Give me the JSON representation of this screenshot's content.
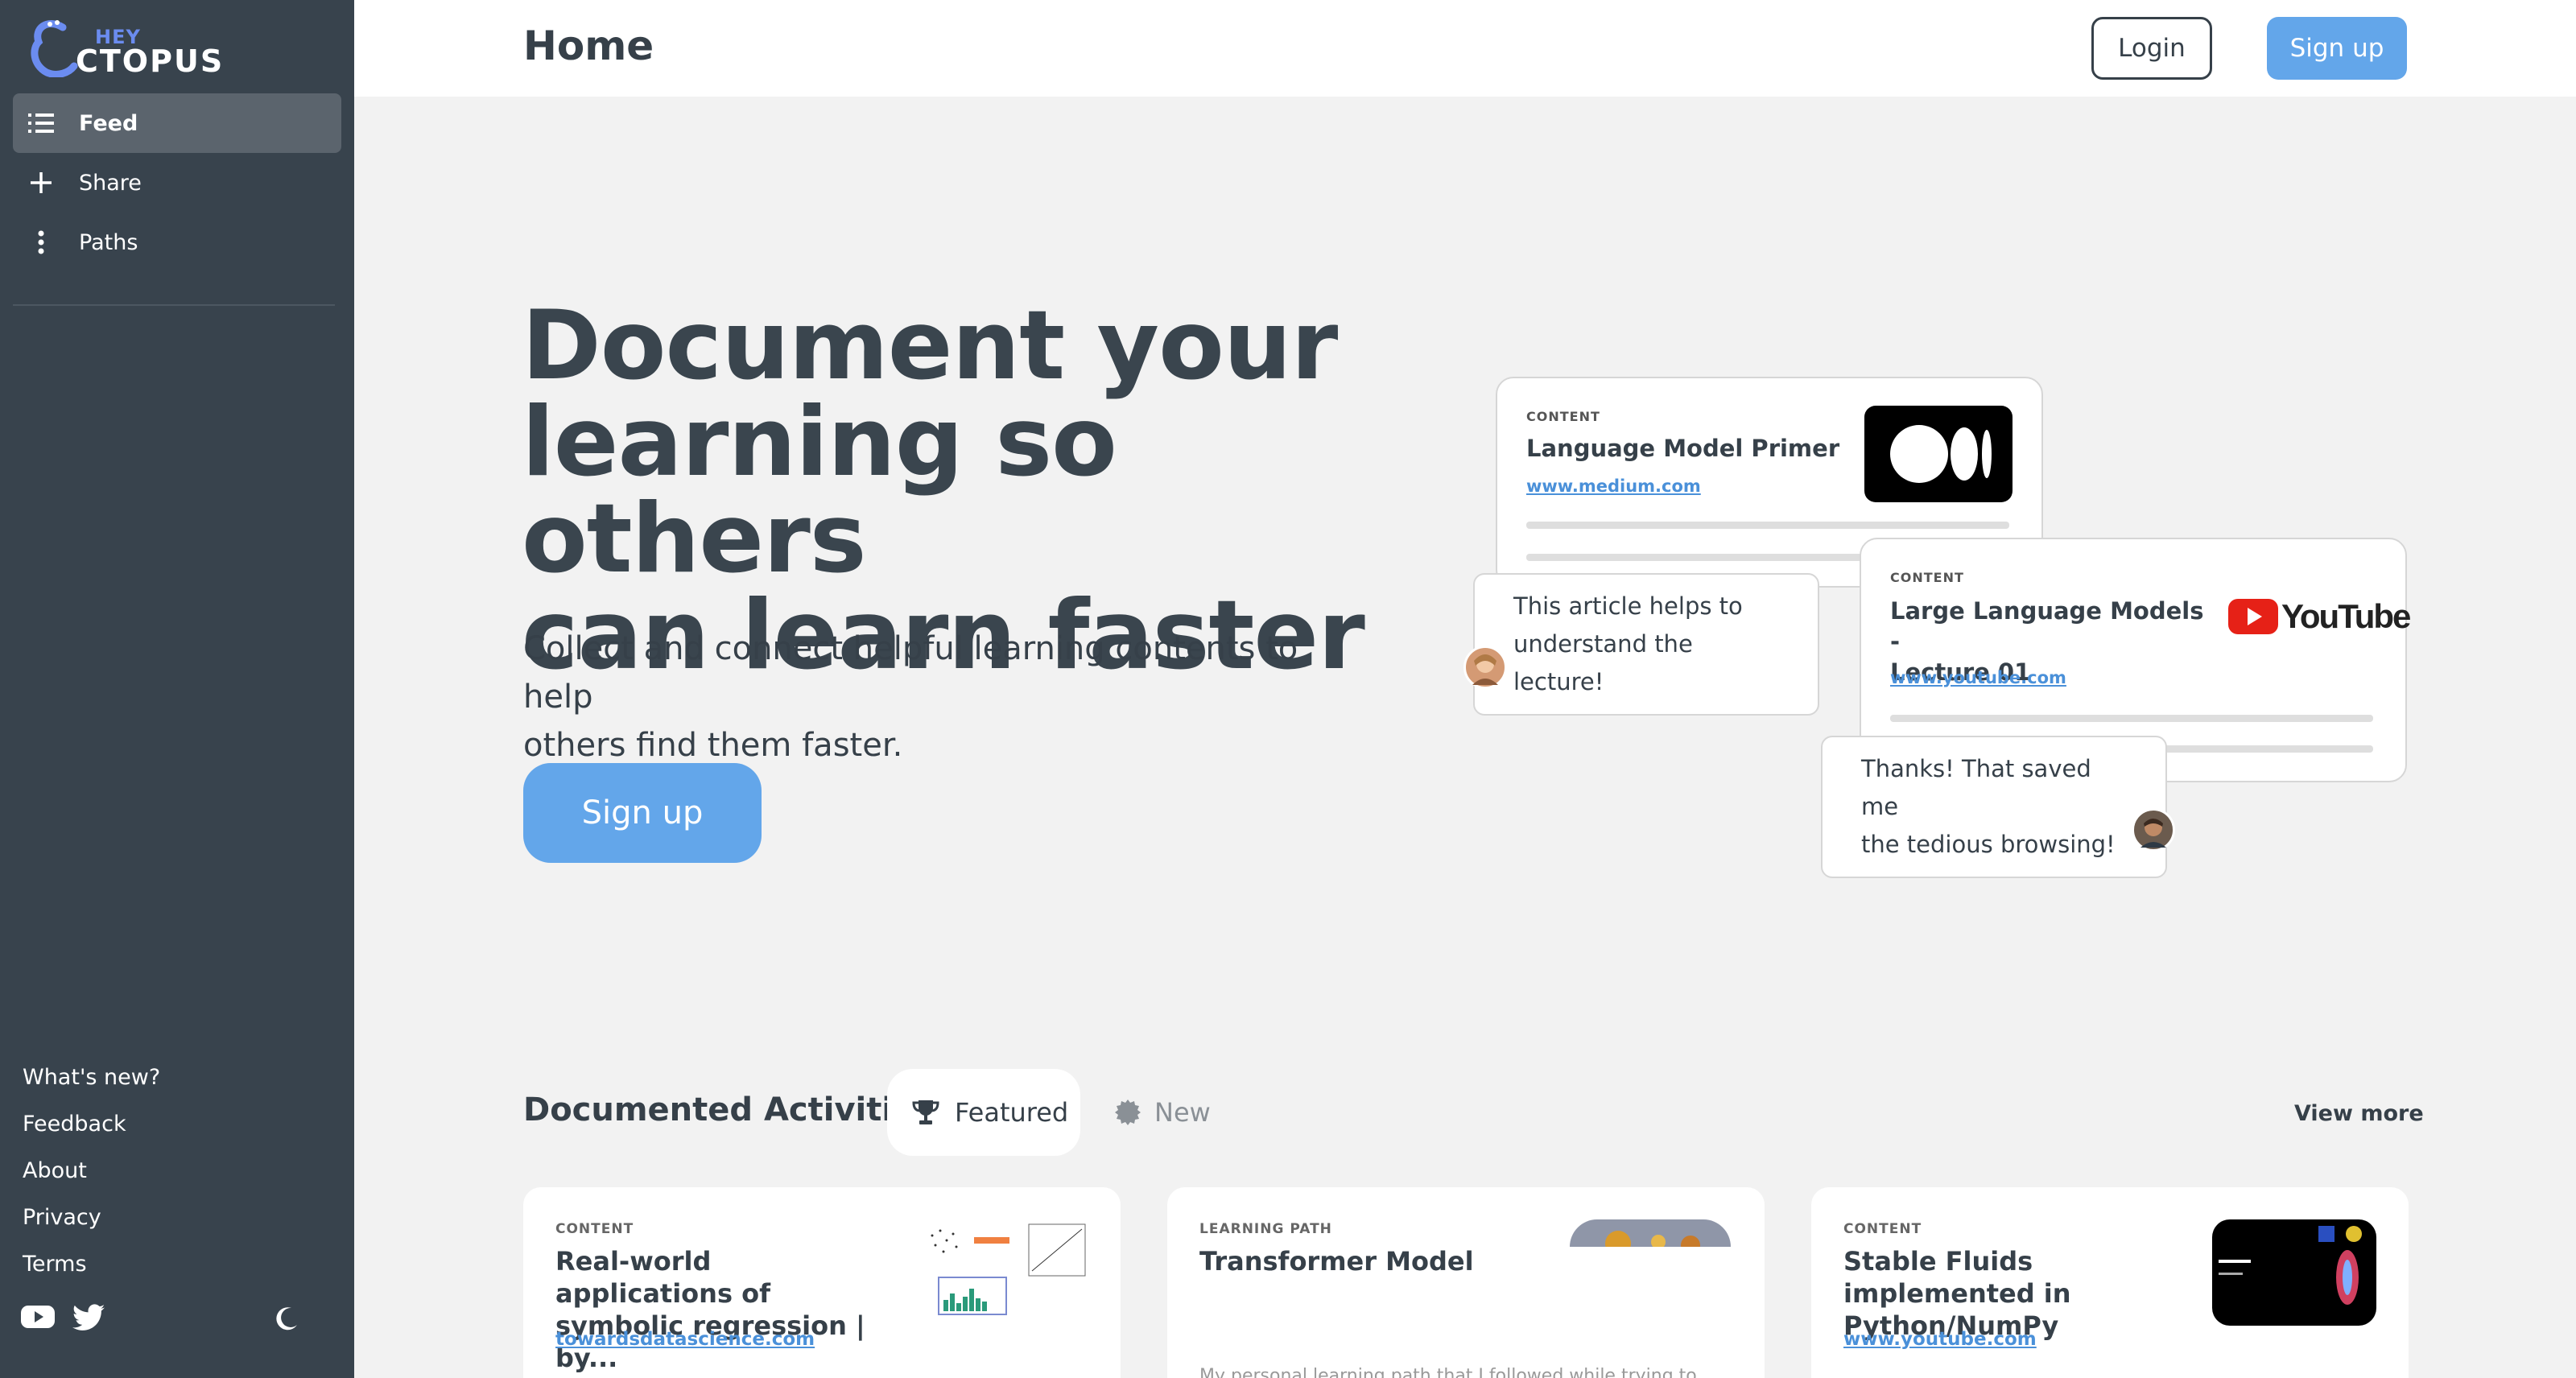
{
  "brand": {
    "hey": "HEY",
    "name": "CTOPUS"
  },
  "sidebar": {
    "nav": [
      {
        "label": "Feed",
        "icon": "list-icon",
        "active": true
      },
      {
        "label": "Share",
        "icon": "plus-icon",
        "active": false
      },
      {
        "label": "Paths",
        "icon": "more-vertical-icon",
        "active": false
      }
    ],
    "footer": [
      "What's new?",
      "Feedback",
      "About",
      "Privacy",
      "Terms"
    ],
    "social": [
      "youtube-icon",
      "twitter-icon"
    ],
    "theme_toggle": "moon-icon"
  },
  "header": {
    "title": "Home",
    "login": "Login",
    "signup": "Sign up"
  },
  "hero": {
    "title_lines": [
      "Document your",
      "learning so others",
      "can learn faster"
    ],
    "subtitle_lines": [
      "Collect and connect helpful learning contents to help",
      "others find them faster."
    ],
    "cta": "Sign up"
  },
  "illustration": {
    "card1": {
      "tag": "CONTENT",
      "title": "Language Model Primer",
      "link": "www.medium.com"
    },
    "card2": {
      "tag": "CONTENT",
      "title_lines": [
        "Large Language Models -",
        "Lecture 01"
      ],
      "link": "www.youtube.com",
      "logo_text": "YouTube"
    },
    "bubble1": [
      "This article helps to",
      "understand the lecture!"
    ],
    "bubble2": [
      "Thanks! That saved me",
      "the tedious browsing!"
    ]
  },
  "activities": {
    "title": "Documented Activities",
    "tabs": [
      "Featured",
      "New"
    ],
    "view_more": "View more",
    "cards": [
      {
        "tag": "CONTENT",
        "title_lines": [
          "Real-world applications of",
          "symbolic regression | by..."
        ],
        "link": "towardsdatascience.com"
      },
      {
        "tag": "LEARNING PATH",
        "title_lines": [
          "Transformer Model",
          ""
        ],
        "desc": "My personal learning path that I followed while trying to"
      },
      {
        "tag": "CONTENT",
        "title_lines": [
          "Stable Fluids implemented in",
          "Python/NumPy"
        ],
        "link": "www.youtube.com"
      }
    ]
  },
  "colors": {
    "sidebar": "#38434d",
    "accent": "#63a6ea",
    "text": "#364049",
    "link": "#4a90d9"
  }
}
